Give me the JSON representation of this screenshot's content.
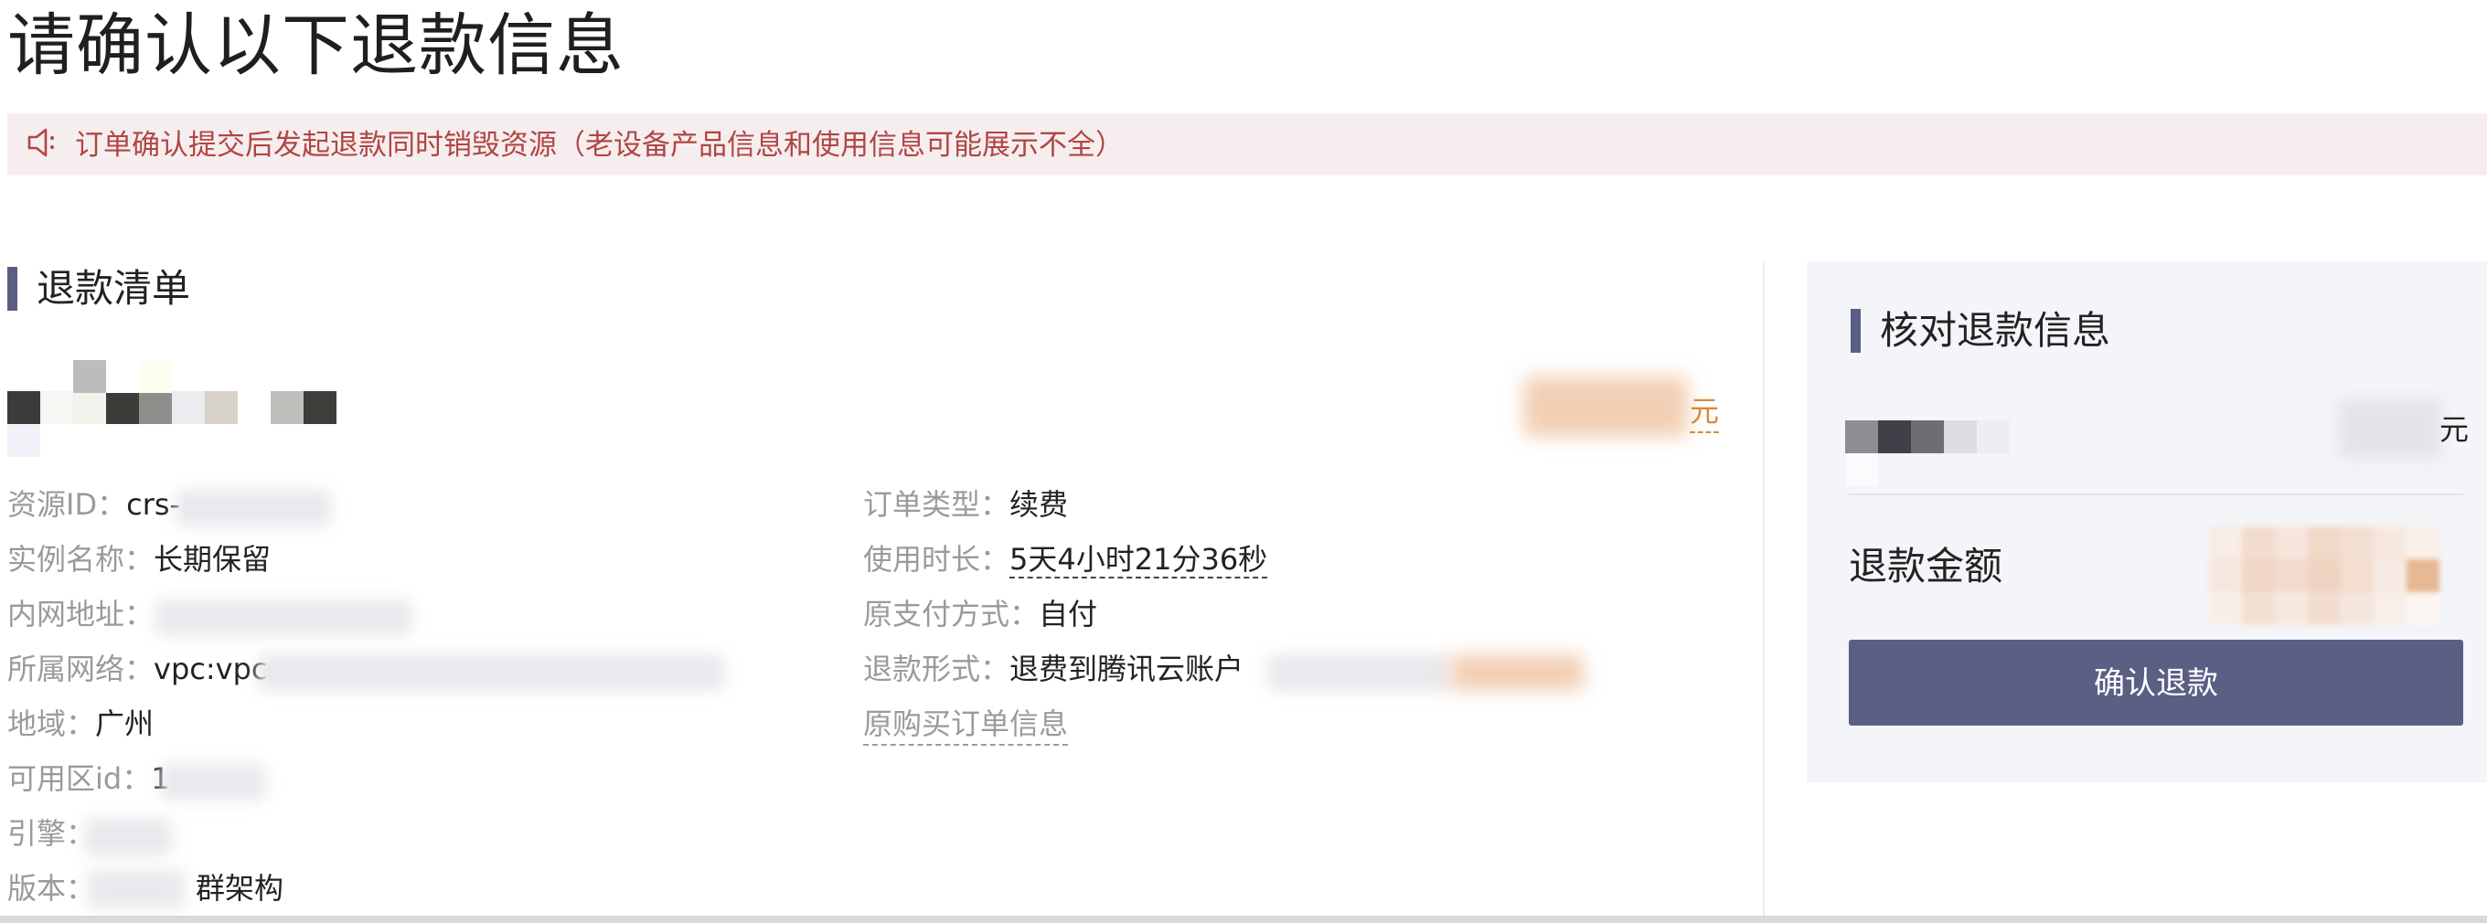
{
  "page": {
    "title": "请确认以下退款信息"
  },
  "notice": {
    "icon": "speaker-icon",
    "text": "订单确认提交后发起退款同时销毁资源（老设备产品信息和使用信息可能展示不全）"
  },
  "refund_list": {
    "title": "退款清单",
    "price_unit": "元",
    "left_fields": [
      {
        "label": "资源ID：",
        "value": "crs-"
      },
      {
        "label": "实例名称：",
        "value": "长期保留"
      },
      {
        "label": "内网地址：",
        "value": ""
      },
      {
        "label": "所属网络：",
        "value": "vpc:vpc"
      },
      {
        "label": "地域：",
        "value": "广州"
      },
      {
        "label": "可用区id：",
        "value": "1"
      },
      {
        "label": "引擎：",
        "value": ""
      },
      {
        "label": "版本：",
        "value": "群架构"
      }
    ],
    "right_fields": [
      {
        "label": "订单类型：",
        "value": "续费"
      },
      {
        "label": "使用时长：",
        "value": "5天4小时21分36秒"
      },
      {
        "label": "原支付方式：",
        "value": "自付"
      },
      {
        "label": "退款形式：",
        "value": "退费到腾讯云账户"
      }
    ],
    "original_order_link": "原购买订单信息"
  },
  "check_panel": {
    "title": "核对退款信息",
    "price_unit": "元",
    "refund_amount_label": "退款金额",
    "confirm_button": "确认退款"
  },
  "colors": {
    "accent": "#5b5f84",
    "notice_bg": "#f6eeee",
    "notice_text": "#b14545",
    "price_unit": "#d98a3a"
  }
}
